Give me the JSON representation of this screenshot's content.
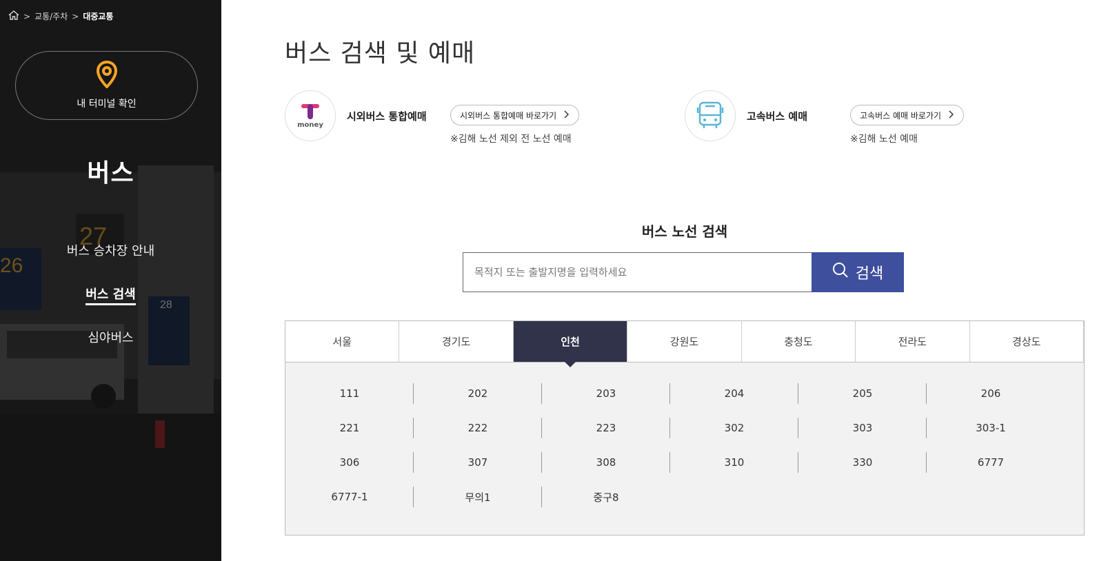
{
  "breadcrumb": {
    "home_icon": "home-icon",
    "items": [
      "교통/주차",
      "대중교통"
    ],
    "separator": ">"
  },
  "sidebar": {
    "terminal_button_label": "내 터미널 확인",
    "title": "버스",
    "menu": [
      {
        "label": "버스 승차장 안내",
        "active": false
      },
      {
        "label": "버스 검색",
        "active": true
      },
      {
        "label": "심야버스",
        "active": false
      }
    ]
  },
  "main": {
    "page_title": "버스 검색 및 예매",
    "booking": [
      {
        "name": "시외버스 통합예매",
        "logo_text": "money",
        "button": "시외버스 통합예매 바로가기",
        "note": "※김해 노선 제외 전 노선 예매"
      },
      {
        "name": "고속버스 예매",
        "logo_icon": "bus-icon",
        "button": "고속버스 예매 바로가기",
        "note": "※김해 노선 예매"
      }
    ],
    "search": {
      "title": "버스 노선 검색",
      "placeholder": "목적지 또는 출발지명을 입력하세요",
      "button_label": "검색"
    },
    "regions": [
      "서울",
      "경기도",
      "인천",
      "강원도",
      "충청도",
      "전라도",
      "경상도"
    ],
    "active_region": "인천",
    "routes": [
      "111",
      "202",
      "203",
      "204",
      "205",
      "206",
      "221",
      "222",
      "223",
      "302",
      "303",
      "303-1",
      "306",
      "307",
      "308",
      "310",
      "330",
      "6777",
      "6777-1",
      "무의1",
      "중구8"
    ]
  },
  "colors": {
    "accent_blue": "#3e4f9e",
    "active_tab": "#30334a",
    "pin_orange": "#f5a623",
    "bus_icon_blue": "#5ab4d6",
    "tmoney_purple": "#7a2c8f",
    "tmoney_pink": "#e0377a"
  }
}
